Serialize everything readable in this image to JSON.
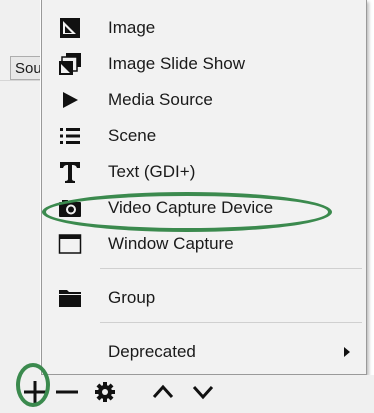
{
  "background": {
    "tab_label": "Sou"
  },
  "menu": {
    "items": [
      {
        "label": "Image",
        "icon": "image-icon"
      },
      {
        "label": "Image Slide Show",
        "icon": "image-slideshow-icon"
      },
      {
        "label": "Media Source",
        "icon": "play-icon"
      },
      {
        "label": "Scene",
        "icon": "list-icon"
      },
      {
        "label": "Text (GDI+)",
        "icon": "text-icon"
      },
      {
        "label": "Video Capture Device",
        "icon": "camera-icon"
      },
      {
        "label": "Window Capture",
        "icon": "window-icon"
      },
      {
        "label": "Group",
        "icon": "folder-icon"
      },
      {
        "label": "Deprecated",
        "icon": "submenu-arrow-icon"
      }
    ]
  },
  "toolbar": {
    "buttons": [
      "add-icon",
      "remove-icon",
      "gear-icon",
      "chevron-up-icon",
      "chevron-down-icon"
    ]
  },
  "annotation_color": "#3b8a4e"
}
